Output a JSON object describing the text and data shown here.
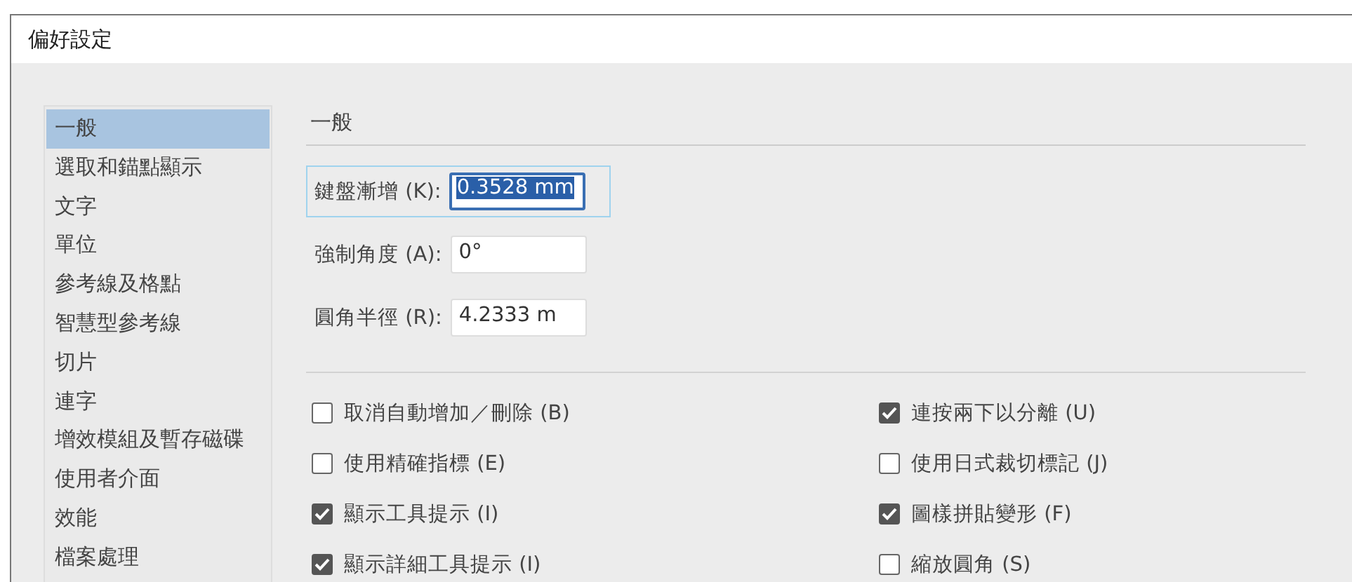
{
  "window": {
    "title": "偏好設定"
  },
  "sidebar": {
    "items": [
      {
        "label": "一般",
        "selected": true
      },
      {
        "label": "選取和錨點顯示",
        "selected": false
      },
      {
        "label": "文字",
        "selected": false
      },
      {
        "label": "單位",
        "selected": false
      },
      {
        "label": "參考線及格點",
        "selected": false
      },
      {
        "label": "智慧型參考線",
        "selected": false
      },
      {
        "label": "切片",
        "selected": false
      },
      {
        "label": "連字",
        "selected": false
      },
      {
        "label": "增效模組及暫存磁碟",
        "selected": false
      },
      {
        "label": "使用者介面",
        "selected": false
      },
      {
        "label": "效能",
        "selected": false
      },
      {
        "label": "檔案處理",
        "selected": false
      }
    ]
  },
  "section": {
    "title": "一般"
  },
  "fields": [
    {
      "label": "鍵盤漸增 (K):",
      "value": "0.3528 mm",
      "focused": true
    },
    {
      "label": "強制角度 (A):",
      "value": "0°",
      "focused": false
    },
    {
      "label": "圓角半徑 (R):",
      "value": "4.2333 m",
      "focused": false
    }
  ],
  "left_options": [
    {
      "label": "取消自動增加／刪除 (B)",
      "checked": false
    },
    {
      "label": "使用精確指標 (E)",
      "checked": false
    },
    {
      "label": "顯示工具提示 (I)",
      "checked": true
    },
    {
      "label": "顯示詳細工具提示 (I)",
      "checked": true
    }
  ],
  "right_options": [
    {
      "label": "連按兩下以分離 (U)",
      "checked": true
    },
    {
      "label": "使用日式裁切標記 (J)",
      "checked": false
    },
    {
      "label": "圖樣拼貼變形 (F)",
      "checked": true
    },
    {
      "label": "縮放圓角 (S)",
      "checked": false
    }
  ]
}
